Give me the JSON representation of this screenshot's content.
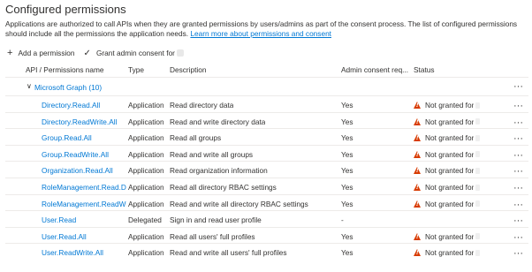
{
  "title": "Configured permissions",
  "description": "Applications are authorized to call APIs when they are granted permissions by users/admins as part of the consent process. The list of configured permissions should include all the permissions the application needs.",
  "learn_more": "Learn more about permissions and consent",
  "toolbar": {
    "add_label": "Add a permission",
    "grant_label": "Grant admin consent for"
  },
  "columns": {
    "name": "API / Permissions name",
    "type": "Type",
    "description": "Description",
    "admin": "Admin consent req...",
    "status": "Status"
  },
  "group": {
    "label": "Microsoft Graph (10)"
  },
  "rows": [
    {
      "name": "Directory.Read.All",
      "type": "Application",
      "description": "Read directory data",
      "admin": "Yes",
      "status": "Not granted for"
    },
    {
      "name": "Directory.ReadWrite.All",
      "type": "Application",
      "description": "Read and write directory data",
      "admin": "Yes",
      "status": "Not granted for"
    },
    {
      "name": "Group.Read.All",
      "type": "Application",
      "description": "Read all groups",
      "admin": "Yes",
      "status": "Not granted for"
    },
    {
      "name": "Group.ReadWrite.All",
      "type": "Application",
      "description": "Read and write all groups",
      "admin": "Yes",
      "status": "Not granted for"
    },
    {
      "name": "Organization.Read.All",
      "type": "Application",
      "description": "Read organization information",
      "admin": "Yes",
      "status": "Not granted for"
    },
    {
      "name": "RoleManagement.Read.Directo",
      "type": "Application",
      "description": "Read all directory RBAC settings",
      "admin": "Yes",
      "status": "Not granted for"
    },
    {
      "name": "RoleManagement.ReadWrite.D",
      "type": "Application",
      "description": "Read and write all directory RBAC settings",
      "admin": "Yes",
      "status": "Not granted for"
    },
    {
      "name": "User.Read",
      "type": "Delegated",
      "description": "Sign in and read user profile",
      "admin": "-",
      "status": ""
    },
    {
      "name": "User.Read.All",
      "type": "Application",
      "description": "Read all users' full profiles",
      "admin": "Yes",
      "status": "Not granted for"
    },
    {
      "name": "User.ReadWrite.All",
      "type": "Application",
      "description": "Read and write all users' full profiles",
      "admin": "Yes",
      "status": "Not granted for"
    }
  ],
  "icons": {
    "add": "plus-icon",
    "grant": "checkmark-icon",
    "expand": "chevron-down-icon",
    "warning": "warning-icon",
    "more": "more-icon"
  },
  "colors": {
    "link": "#0078d4",
    "warning": "#d83b01",
    "text": "#323130",
    "divider": "#edebe9"
  }
}
